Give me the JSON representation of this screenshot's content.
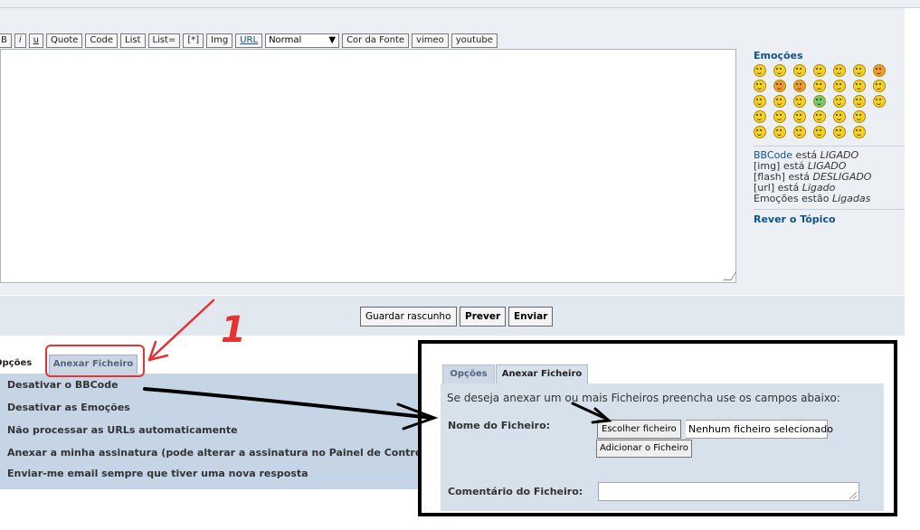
{
  "toolbar": {
    "bold": "B",
    "italic": "i",
    "underline": "u",
    "quote": "Quote",
    "code": "Code",
    "list": "List",
    "list_eq": "List=",
    "list_item": "[*]",
    "img": "Img",
    "url": "URL",
    "font_size": "Normal",
    "font_color": "Cor da Fonte",
    "vimeo": "vimeo",
    "youtube": "youtube"
  },
  "sidebar": {
    "title": "Emoções",
    "bbcode_link": "BBCode",
    "bbcode_text": " está ",
    "bbcode_state": "LIGADO",
    "img_text": "[img] está ",
    "img_state": "LIGADO",
    "flash_text": "[flash] está ",
    "flash_state": "DESLIGADO",
    "url_text": "[url] está ",
    "url_state": "Ligado",
    "emotions_text": "Emoções estão ",
    "emotions_state": "Ligadas",
    "review": "Rever o Tópico"
  },
  "actions": {
    "save_draft": "Guardar rascunho",
    "preview": "Prever",
    "submit": "Enviar"
  },
  "annotation": {
    "number": "1"
  },
  "tabs": {
    "options": "Opções",
    "attach": "Anexar Ficheiro"
  },
  "options": [
    "Desativar o BBCode",
    "Desativar as Emoções",
    "Não processar as URLs automaticamente",
    "Anexar a minha assinatura (pode alterar a assinatura no Painel de Controlo do",
    "Enviar-me email sempre que tiver uma nova resposta"
  ],
  "attach_panel": {
    "tab_options": "Opções",
    "tab_attach": "Anexar Ficheiro",
    "intro": "Se deseja anexar um ou mais Ficheiros preencha use os campos abaixo:",
    "file_label": "Nome do Ficheiro:",
    "choose_button": "Escolher ficheiro",
    "no_file": "Nenhum ficheiro selecionado",
    "add_button": "Adicionar o Ficheiro",
    "comment_label": "Comentário do Ficheiro:"
  },
  "colors": {
    "link": "#105289",
    "panel": "#ecf0f5",
    "options_bg": "#c5d5e6",
    "annotation_red": "#e53333"
  }
}
